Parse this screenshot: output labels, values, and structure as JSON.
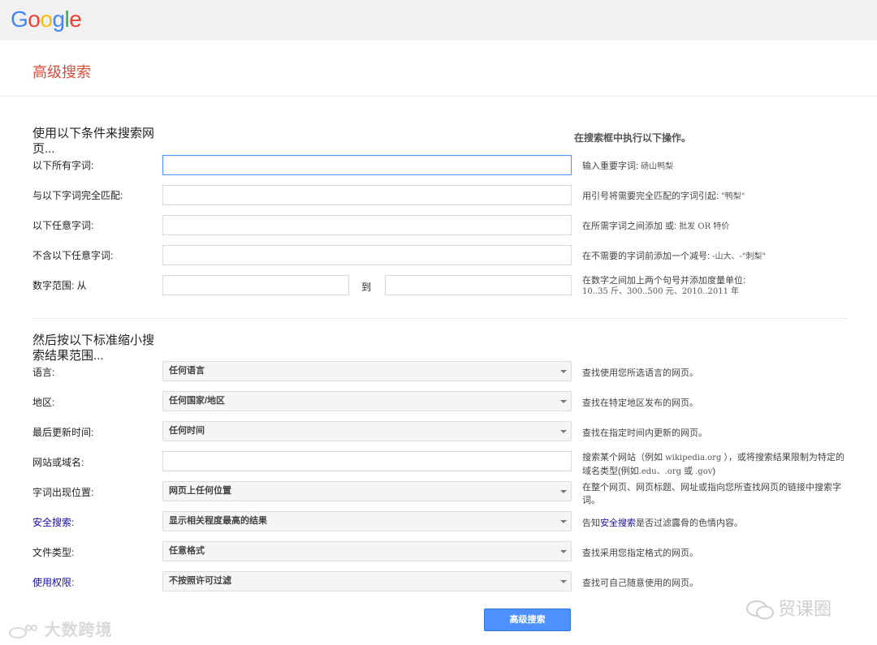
{
  "header": {
    "logo_letters": [
      {
        "ch": "G",
        "color": "#4285f4"
      },
      {
        "ch": "o",
        "color": "#ea4335"
      },
      {
        "ch": "o",
        "color": "#fbbc05"
      },
      {
        "ch": "g",
        "color": "#4285f4"
      },
      {
        "ch": "l",
        "color": "#34a853"
      },
      {
        "ch": "e",
        "color": "#ea4335"
      }
    ]
  },
  "page_title": "高级搜索",
  "section1": {
    "title": "使用以下条件来搜索网页...",
    "right_heading": "在搜索框中执行以下操作。",
    "fields": [
      {
        "label": "以下所有字词:",
        "value": "",
        "hint_text": "输入重要字词:",
        "hint_example": "砀山鸭梨"
      },
      {
        "label": "与以下字词完全匹配:",
        "value": "",
        "hint_text": "用引号将需要完全匹配的字词引起:",
        "hint_example": "\"鸭梨\""
      },
      {
        "label": "以下任意字词:",
        "value": "",
        "hint_text": "在所需字词之间添加 或:",
        "hint_example": "批发 OR 特价"
      },
      {
        "label": "不含以下任意字词:",
        "value": "",
        "hint_text": "在不需要的字词前添加一个减号:",
        "hint_example": "-山大、-\"刺梨\""
      }
    ],
    "range": {
      "label": "数字范围: 从",
      "to_label": "到",
      "from_value": "",
      "to_value": "",
      "hint_text": "在数字之间加上两个句号并添加度量单位:",
      "hint_example": "10..35 斤、300..500 元、2010..2011 年"
    }
  },
  "section2": {
    "title": "然后按以下标准缩小搜索结果范围...",
    "rows": [
      {
        "label": "语言:",
        "value": "任何语言",
        "hint": "查找使用您所选语言的网页。"
      },
      {
        "label": "地区:",
        "value": "任何国家/地区",
        "hint": "查找在特定地区发布的网页。"
      },
      {
        "label": "最后更新时间:",
        "value": "任何时间",
        "hint": "查找在指定时间内更新的网页。"
      },
      {
        "label": "网站或域名:",
        "value": "",
        "hint_line1_a": "搜索某个网站（例如",
        "hint_line1_code": "wikipedia.org",
        "hint_line1_b": "），或将搜索结果限制为特定的",
        "hint_line2_a": "域名类型(例如",
        "hint_line2_code": ".edu、.org",
        "hint_line2_b": "或",
        "hint_line2_code2": ".gov",
        "hint_line2_c": ")"
      },
      {
        "label": "字词出现位置:",
        "value": "网页上任何位置",
        "hint": "在整个网页、网页标题、网址或指向您所查找网页的链接中搜索字词。"
      },
      {
        "label": "安全搜索:",
        "value": "显示相关程度最高的结果",
        "hint_a": "告知",
        "hint_link": "安全搜索",
        "hint_b": "是否过滤露骨的色情内容。"
      },
      {
        "label": "文件类型:",
        "value": "任意格式",
        "hint": "查找采用您指定格式的网页。"
      },
      {
        "label": "使用权限:",
        "value": "不按照许可过滤",
        "hint": "查找可自己随意使用的网页。"
      }
    ]
  },
  "submit_label": "高级搜索",
  "watermarks": {
    "left": "大数跨境",
    "right": "贸课圈"
  },
  "colors": {
    "accent_red": "#dd4b39",
    "button_blue": "#4d90fe",
    "link_blue": "#1a0dab"
  }
}
